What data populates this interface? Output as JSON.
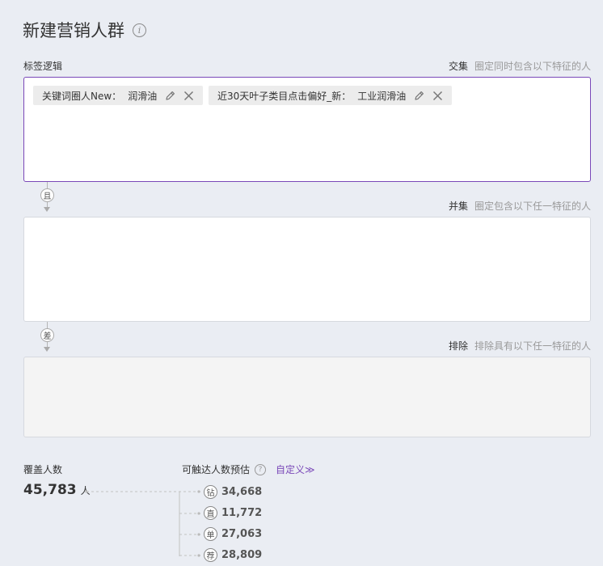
{
  "page": {
    "title": "新建营销人群"
  },
  "tag_logic": {
    "label": "标签逻辑",
    "intersection": {
      "key": "交集",
      "desc": "圈定同时包含以下特征的人",
      "tags": [
        {
          "name": "关键词圈人New：",
          "value": "润滑油"
        },
        {
          "name": "近30天叶子类目点击偏好_新：",
          "value": "工业润滑油"
        }
      ]
    },
    "connector_and": "且",
    "union": {
      "key": "并集",
      "desc": "圈定包含以下任一特征的人"
    },
    "connector_diff": "差",
    "exclude": {
      "key": "排除",
      "desc": "排除具有以下任一特征的人"
    }
  },
  "coverage": {
    "label": "覆盖人数",
    "value": "45,783",
    "unit": "人"
  },
  "reach": {
    "label": "可触达人数预估",
    "help": "?",
    "custom_link": "自定义≫",
    "channels": [
      {
        "badge": "钻",
        "value": "34,668"
      },
      {
        "badge": "直",
        "value": "11,772"
      },
      {
        "badge": "单",
        "value": "27,063"
      },
      {
        "badge": "荐",
        "value": "28,809"
      }
    ]
  }
}
